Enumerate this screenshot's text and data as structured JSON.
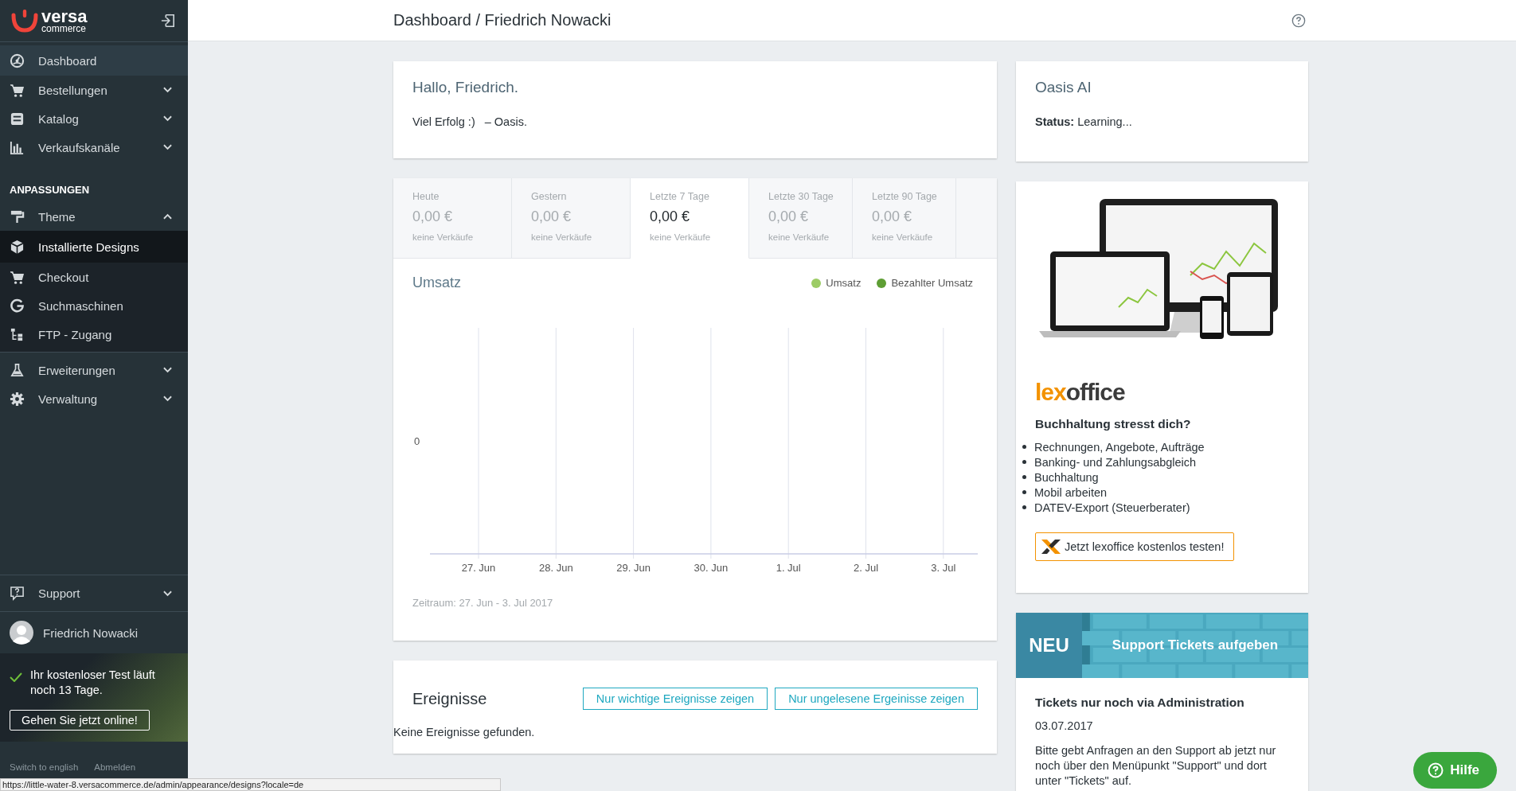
{
  "sidebar": {
    "logo": {
      "name": "versa",
      "sub": "commerce"
    },
    "menu": [
      {
        "kind": "item",
        "label": "Dashboard",
        "hovered": true
      },
      {
        "kind": "group",
        "label": "Bestellungen",
        "hovered": false,
        "expanded": false
      },
      {
        "kind": "group",
        "label": "Katalog",
        "hovered": false,
        "expanded": false
      },
      {
        "kind": "group",
        "label": "Verkaufskanäle",
        "hovered": false,
        "expanded": false
      },
      {
        "kind": "heading",
        "label": "ANPASSUNGEN"
      },
      {
        "kind": "group",
        "label": "Theme",
        "hovered": false,
        "expanded": true,
        "children": [
          {
            "label": "Installierte Designs",
            "selected": true
          },
          {
            "label": "Checkout",
            "selected": false
          },
          {
            "label": "Suchmaschinen",
            "selected": false
          },
          {
            "label": "FTP - Zugang",
            "selected": false
          }
        ]
      },
      {
        "kind": "group",
        "label": "Erweiterungen",
        "hovered": false,
        "expanded": false
      },
      {
        "kind": "group",
        "label": "Verwaltung",
        "hovered": false,
        "expanded": false
      }
    ],
    "support": {
      "label": "Support",
      "expanded": false
    },
    "user": {
      "name": "Friedrich Nowacki"
    },
    "trial": {
      "message": "Ihr kostenloser Test läuft noch 13 Tage.",
      "button": "Gehen Sie jetzt online!"
    },
    "footer_links": [
      "Switch to english",
      "Abmelden"
    ]
  },
  "header": {
    "title": "Dashboard / Friedrich Nowacki"
  },
  "greeting": {
    "title": "Hallo, Friedrich.",
    "parts": [
      "Viel Erfolg :)",
      "– Oasis."
    ]
  },
  "oasis": {
    "title": "Oasis AI",
    "status": "**Status:** Learning..."
  },
  "stats": {
    "tabs": [
      {
        "label": "Heute",
        "value": "0,00 €",
        "note": "keine Verkäufe",
        "selected": false
      },
      {
        "label": "Gestern",
        "value": "0,00 €",
        "note": "keine Verkäufe",
        "selected": false
      },
      {
        "label": "Letzte 7 Tage",
        "value": "0,00 €",
        "note": "keine Verkäufe",
        "selected": true
      },
      {
        "label": "Letzte 30 Tage",
        "value": "0,00 €",
        "note": "keine Verkäufe",
        "selected": false
      },
      {
        "label": "Letzte 90 Tage",
        "value": "0,00 €",
        "note": "keine Verkäufe",
        "selected": false
      }
    ]
  },
  "revenue": {
    "title": "Umsatz",
    "legend": [
      {
        "name": "Umsatz",
        "color": "#9ccc65"
      },
      {
        "name": "Bezahlter Umsatz",
        "color": "#5e9e34"
      }
    ],
    "y_label": "0",
    "x_labels": [
      "27. Jun",
      "28. Jun",
      "29. Jun",
      "30. Jun",
      "1. Jul",
      "2. Jul",
      "3. Jul"
    ],
    "period": "Zeitraum: 27. Jun - 3. Jul 2017"
  },
  "events": {
    "title": "Ereignisse",
    "buttons": [
      "Nur wichtige Ereignisse zeigen",
      "Nur ungelesene Ergeinisse zeigen"
    ],
    "empty": "Keine Ereignisse gefunden."
  },
  "lexoffice": {
    "logo_a": "lex",
    "logo_b": "office",
    "heading": "Buchhaltung stresst dich?",
    "features": [
      "Rechnungen, Angebote, Aufträge",
      "Banking- und Zahlungsabgleich",
      "Buchhaltung",
      "Mobil arbeiten",
      "DATEV-Export (Steuerberater)"
    ],
    "button": "Jetzt lexoffice kostenlos testen!"
  },
  "news": {
    "badge": "NEU",
    "banner": "Support Tickets aufgeben",
    "title": "Tickets nur noch via Administration",
    "date": "03.07.2017",
    "text": "Bitte gebt Anfragen an den Support ab jetzt nur noch über den Menüpunkt \"Support\" und dort unter \"Tickets\" auf."
  },
  "help_button": "Hilfe",
  "status_url": "https://little-water-8.versacommerce.de/admin/appearance/designs?locale=de"
}
